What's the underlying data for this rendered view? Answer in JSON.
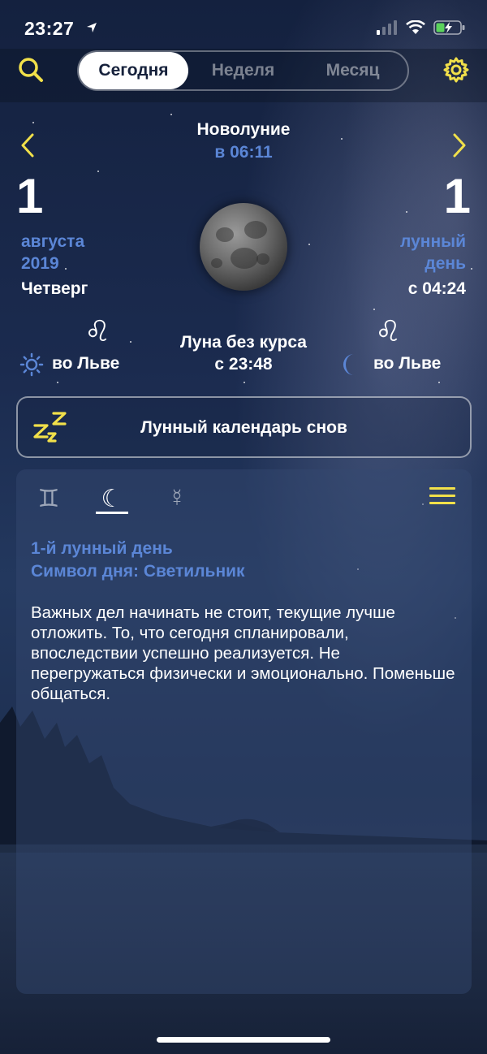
{
  "status": {
    "time": "23:27"
  },
  "nav": {
    "tabs": [
      {
        "label": "Сегодня",
        "active": true
      },
      {
        "label": "Неделя",
        "active": false
      },
      {
        "label": "Месяц",
        "active": false
      }
    ],
    "accent_color": "#f1e04a"
  },
  "phase": {
    "name": "Новолуние",
    "time": "в 06:11"
  },
  "date": {
    "day": "1",
    "month": "августа",
    "year": "2019",
    "weekday": "Четверг"
  },
  "lunar": {
    "day": "1",
    "label_line1": "лунный",
    "label_line2": "день",
    "since": "с 04:24"
  },
  "signs": {
    "sun_symbol": "♌",
    "sun_label": "во Льве",
    "moon_symbol": "♌",
    "moon_label": "во Льве",
    "course_line1": "Луна без курса",
    "course_line2": "с 23:48"
  },
  "dream_button": {
    "label": "Лунный календарь снов"
  },
  "panel": {
    "tab_icons": [
      "♊",
      "☾",
      "☿"
    ],
    "title_line1": "1-й лунный день",
    "title_line2": "Символ дня: Светильник",
    "description": "Важных дел начинать не стоит, текущие лучше отложить. То, что сегодня спланировали, впоследствии успешно реализуется. Не перегружаться физически и эмоционально. Поменьше общаться."
  }
}
